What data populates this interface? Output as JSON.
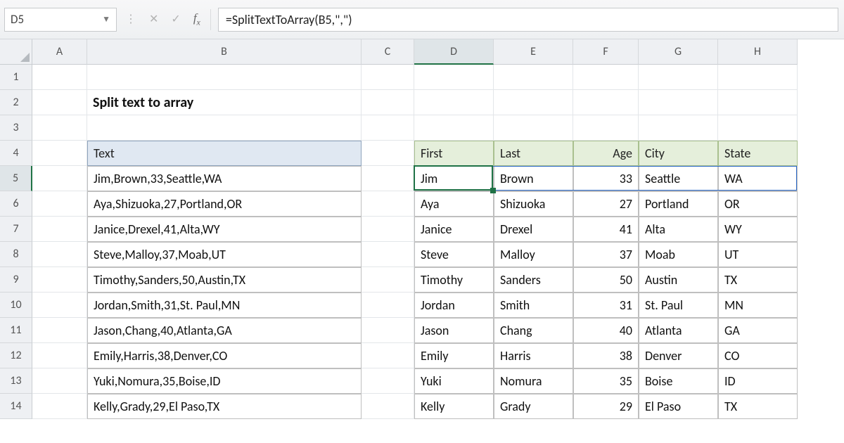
{
  "namebox": {
    "value": "D5"
  },
  "formula": "=SplitTextToArray(B5,\",\")",
  "title": "Split text to array",
  "columns": [
    "A",
    "B",
    "C",
    "D",
    "E",
    "F",
    "G",
    "H"
  ],
  "rows": [
    "1",
    "2",
    "3",
    "4",
    "5",
    "6",
    "7",
    "8",
    "9",
    "10",
    "11",
    "12",
    "13",
    "14"
  ],
  "activeCell": "D5",
  "activeColumn": "D",
  "activeRow": "5",
  "left": {
    "header": "Text",
    "data": [
      "Jim,Brown,33,Seattle,WA",
      "Aya,Shizuoka,27,Portland,OR",
      "Janice,Drexel,41,Alta,WY",
      "Steve,Malloy,37,Moab,UT",
      "Timothy,Sanders,50,Austin,TX",
      "Jordan,Smith,31,St. Paul,MN",
      "Jason,Chang,40,Atlanta,GA",
      "Emily,Harris,38,Denver,CO",
      "Yuki,Nomura,35,Boise,ID",
      "Kelly,Grady,29,El Paso,TX"
    ]
  },
  "right": {
    "headers": [
      "First",
      "Last",
      "Age",
      "City",
      "State"
    ],
    "rows": [
      {
        "first": "Jim",
        "last": "Brown",
        "age": "33",
        "city": "Seattle",
        "state": "WA"
      },
      {
        "first": "Aya",
        "last": "Shizuoka",
        "age": "27",
        "city": "Portland",
        "state": "OR"
      },
      {
        "first": "Janice",
        "last": "Drexel",
        "age": "41",
        "city": "Alta",
        "state": "WY"
      },
      {
        "first": "Steve",
        "last": "Malloy",
        "age": "37",
        "city": "Moab",
        "state": "UT"
      },
      {
        "first": "Timothy",
        "last": "Sanders",
        "age": "50",
        "city": "Austin",
        "state": "TX"
      },
      {
        "first": "Jordan",
        "last": "Smith",
        "age": "31",
        "city": "St. Paul",
        "state": "MN"
      },
      {
        "first": "Jason",
        "last": "Chang",
        "age": "40",
        "city": "Atlanta",
        "state": "GA"
      },
      {
        "first": "Emily",
        "last": "Harris",
        "age": "38",
        "city": "Denver",
        "state": "CO"
      },
      {
        "first": "Yuki",
        "last": "Nomura",
        "age": "35",
        "city": "Boise",
        "state": "ID"
      },
      {
        "first": "Kelly",
        "last": "Grady",
        "age": "29",
        "city": "El Paso",
        "state": "TX"
      }
    ]
  }
}
